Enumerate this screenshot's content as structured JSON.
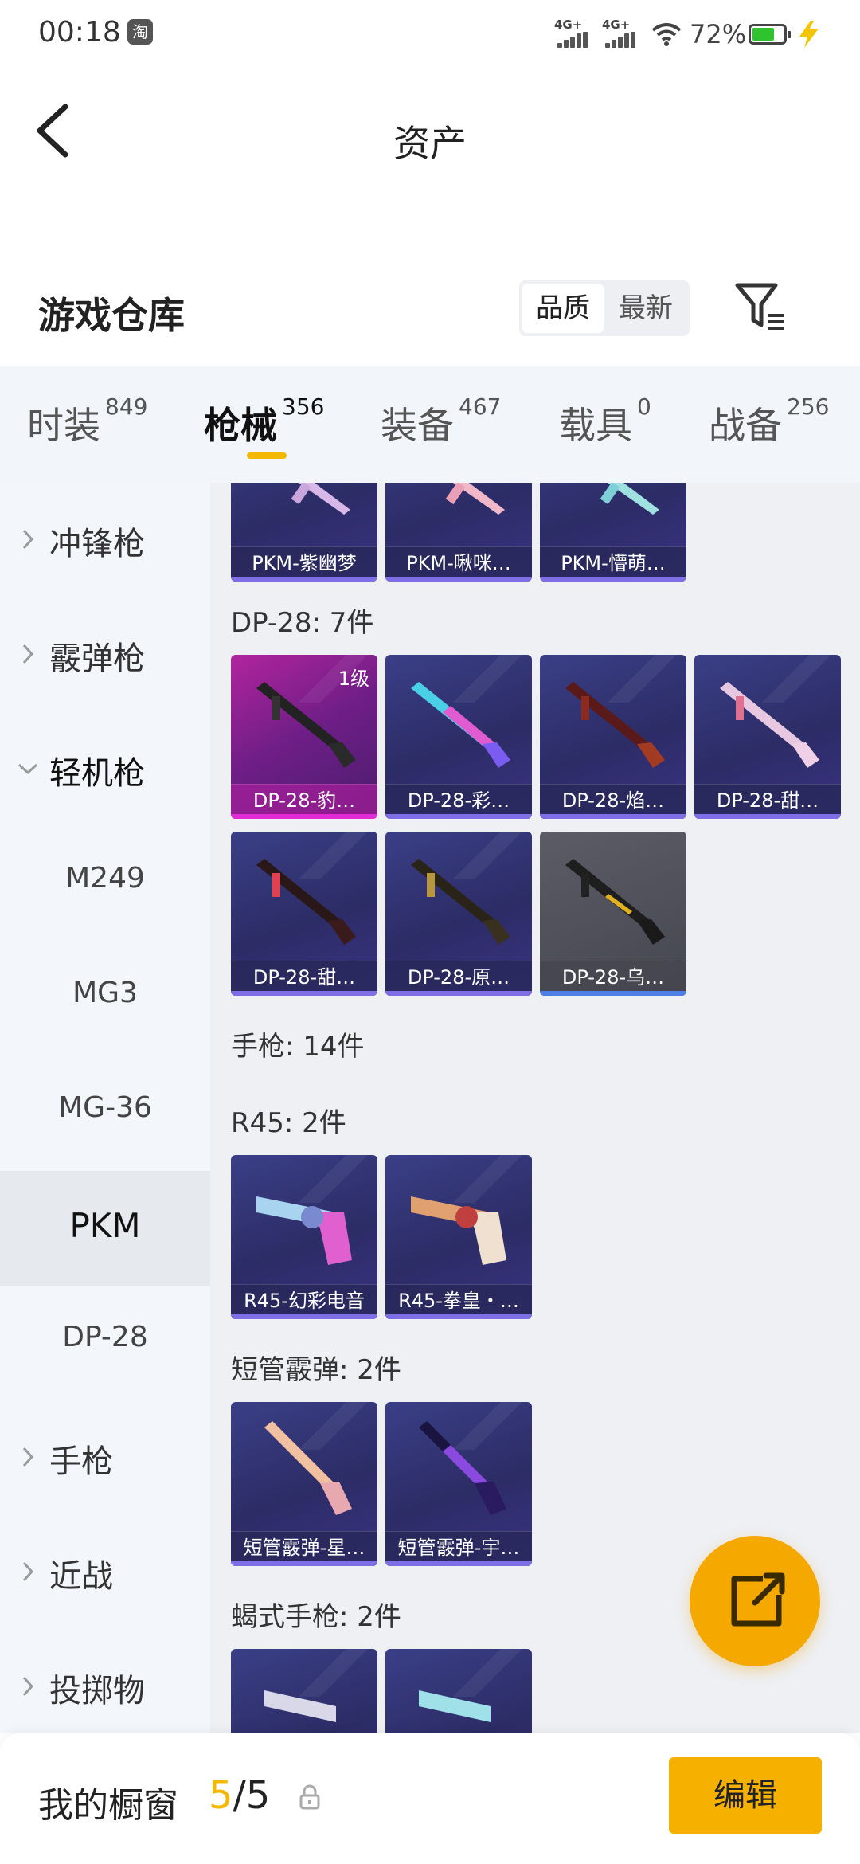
{
  "status_bar": {
    "time": "00:18",
    "app_badge": "淘",
    "network1": "4G+",
    "network2": "4G+",
    "battery_text": "72%",
    "battery_level": 0.72,
    "battery_color": "#2fc32f"
  },
  "header": {
    "title": "资产"
  },
  "warehouse": {
    "title": "游戏仓库",
    "sort_options": [
      "品质",
      "最新"
    ]
  },
  "tabs": [
    {
      "label": "时装",
      "count": "849"
    },
    {
      "label": "枪械",
      "count": "356"
    },
    {
      "label": "装备",
      "count": "467"
    },
    {
      "label": "载具",
      "count": "0"
    },
    {
      "label": "战备",
      "count": "256"
    }
  ],
  "sidebar": [
    {
      "label": "冲锋枪"
    },
    {
      "label": "霰弹枪"
    },
    {
      "label": "轻机枪"
    },
    {
      "label": "M249"
    },
    {
      "label": "MG3"
    },
    {
      "label": "MG-36"
    },
    {
      "label": "PKM"
    },
    {
      "label": "DP-28"
    },
    {
      "label": "手枪"
    },
    {
      "label": "近战"
    },
    {
      "label": "投掷物"
    }
  ],
  "sections": [
    {
      "title": "",
      "items": [
        {
          "name": "PKM-紫幽梦"
        },
        {
          "name": "PKM-啾咪…"
        },
        {
          "name": "PKM-懵萌…"
        }
      ]
    },
    {
      "title": "DP-28: 7件",
      "items": [
        {
          "name": "DP-28-豹…",
          "level": "1级"
        },
        {
          "name": "DP-28-彩…"
        },
        {
          "name": "DP-28-焰…"
        },
        {
          "name": "DP-28-甜…"
        },
        {
          "name": "DP-28-甜…"
        },
        {
          "name": "DP-28-原…"
        },
        {
          "name": "DP-28-乌…"
        }
      ]
    },
    {
      "title": "手枪: 14件"
    },
    {
      "title": "R45: 2件",
      "items": [
        {
          "name": "R45-幻彩电音"
        },
        {
          "name": "R45-拳皇・…"
        }
      ]
    },
    {
      "title": "短管霰弹: 2件",
      "items": [
        {
          "name": "短管霰弹-星…"
        },
        {
          "name": "短管霰弹-宇…"
        }
      ]
    },
    {
      "title": "蝎式手枪: 2件"
    }
  ],
  "showcase": {
    "title": "我的橱窗",
    "current": "5",
    "separator": "/",
    "total": "5",
    "edit_label": "编辑"
  },
  "colors": {
    "accent": "#f5b000",
    "fab": "#f5a800",
    "card_purple": "#2c2c66",
    "card_gold_edge": "#e22bd6",
    "card_grey_edge": "#4d7fe6"
  }
}
